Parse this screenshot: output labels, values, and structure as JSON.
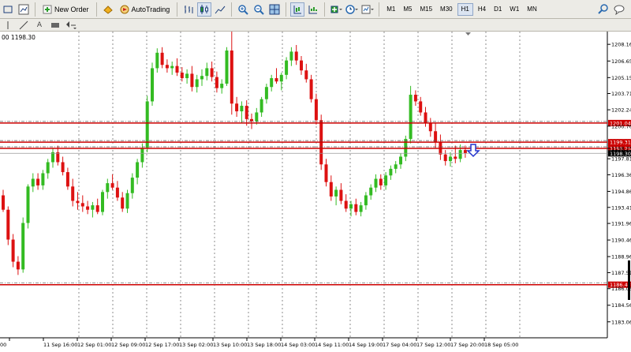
{
  "toolbar": {
    "new_order_label": "New Order",
    "autotrading_label": "AutoTrading",
    "timeframes": [
      "M1",
      "M5",
      "M15",
      "M30",
      "H1",
      "H4",
      "D1",
      "W1",
      "MN"
    ],
    "active_timeframe": "H1"
  },
  "toolbar2": {
    "text_tool_label": "A"
  },
  "chart_header": {
    "price_label": "00 1198.30"
  },
  "chart_data": {
    "type": "candlestick",
    "y_ticks": [
      "1208.16",
      "1206.65",
      "1205.15",
      "1203.71",
      "1202.24",
      "1200.76",
      "1198.75",
      "1197.81",
      "1196.36",
      "1194.86",
      "1193.41",
      "1191.96",
      "1190.46",
      "1188.96",
      "1187.51",
      "1186.06",
      "1184.56",
      "1183.06"
    ],
    "x_ticks": [
      "00",
      "11 Sep 16:00",
      "12 Sep 01:00",
      "12 Sep 09:00",
      "12 Sep 17:00",
      "13 Sep 02:00",
      "13 Sep 10:00",
      "13 Sep 18:00",
      "14 Sep 03:00",
      "14 Sep 11:00",
      "14 Sep 19:00",
      "17 Sep 04:00",
      "17 Sep 12:00",
      "17 Sep 20:00",
      "18 Sep 05:00"
    ],
    "ylim": [
      1182.9,
      1209.1
    ],
    "levels": [
      {
        "label": "1201.04",
        "value": 1201.04,
        "color": "#cc0000"
      },
      {
        "label": "1199.31",
        "value": 1199.31,
        "color": "#cc0000"
      },
      {
        "label": "1198.75",
        "value": 1198.75,
        "color": "#cc0000"
      },
      {
        "label": "1186.42",
        "value": 1186.42,
        "color": "#cc0000"
      }
    ],
    "bid": {
      "label": "1198.30",
      "value": 1198.3
    },
    "up_color": "#33bb22",
    "down_color": "#dd1111",
    "ohlc": [
      [
        1194.5,
        1195.0,
        1193.0,
        1193.2
      ],
      [
        1193.2,
        1193.5,
        1190.0,
        1190.5
      ],
      [
        1190.5,
        1191.0,
        1188.0,
        1188.5
      ],
      [
        1188.5,
        1189.0,
        1187.3,
        1187.8
      ],
      [
        1187.8,
        1192.5,
        1187.5,
        1192.0
      ],
      [
        1192.0,
        1195.5,
        1191.5,
        1195.3
      ],
      [
        1195.3,
        1196.5,
        1194.8,
        1196.0
      ],
      [
        1196.0,
        1196.5,
        1195.0,
        1195.4
      ],
      [
        1195.4,
        1196.8,
        1195.0,
        1196.5
      ],
      [
        1196.5,
        1197.8,
        1196.0,
        1197.5
      ],
      [
        1197.5,
        1198.8,
        1197.0,
        1198.4
      ],
      [
        1198.4,
        1199.0,
        1197.2,
        1197.5
      ],
      [
        1197.5,
        1198.0,
        1196.3,
        1196.6
      ],
      [
        1196.6,
        1197.0,
        1195.0,
        1195.3
      ],
      [
        1195.3,
        1196.0,
        1193.5,
        1194.0
      ],
      [
        1194.0,
        1194.8,
        1193.2,
        1193.8
      ],
      [
        1193.8,
        1194.5,
        1193.0,
        1193.5
      ],
      [
        1193.5,
        1194.0,
        1192.8,
        1193.2
      ],
      [
        1193.2,
        1193.9,
        1192.5,
        1193.6
      ],
      [
        1193.6,
        1194.2,
        1192.8,
        1193.0
      ],
      [
        1193.0,
        1195.0,
        1192.7,
        1194.8
      ],
      [
        1194.8,
        1196.0,
        1194.2,
        1195.6
      ],
      [
        1195.6,
        1196.4,
        1195.0,
        1195.2
      ],
      [
        1195.2,
        1195.8,
        1194.0,
        1194.3
      ],
      [
        1194.3,
        1194.8,
        1193.0,
        1193.3
      ],
      [
        1193.3,
        1195.0,
        1192.9,
        1194.7
      ],
      [
        1194.7,
        1196.5,
        1194.2,
        1196.1
      ],
      [
        1196.1,
        1197.8,
        1195.5,
        1197.5
      ],
      [
        1197.5,
        1199.2,
        1197.0,
        1198.8
      ],
      [
        1198.8,
        1203.5,
        1198.4,
        1203.0
      ],
      [
        1203.0,
        1206.5,
        1202.6,
        1206.0
      ],
      [
        1206.0,
        1207.8,
        1205.6,
        1207.4
      ],
      [
        1207.4,
        1207.9,
        1206.0,
        1206.3
      ],
      [
        1206.3,
        1206.8,
        1205.6,
        1206.0
      ],
      [
        1206.0,
        1206.6,
        1205.4,
        1206.2
      ],
      [
        1206.2,
        1206.9,
        1205.3,
        1205.6
      ],
      [
        1205.6,
        1206.1,
        1204.8,
        1205.1
      ],
      [
        1205.1,
        1205.9,
        1204.6,
        1205.5
      ],
      [
        1205.5,
        1206.2,
        1203.9,
        1204.3
      ],
      [
        1204.3,
        1205.4,
        1203.8,
        1205.0
      ],
      [
        1205.0,
        1205.9,
        1204.4,
        1205.3
      ],
      [
        1205.3,
        1206.5,
        1204.9,
        1206.0
      ],
      [
        1206.0,
        1206.6,
        1204.8,
        1205.2
      ],
      [
        1205.2,
        1205.7,
        1203.8,
        1204.2
      ],
      [
        1204.2,
        1205.0,
        1203.7,
        1204.6
      ],
      [
        1204.6,
        1207.9,
        1204.4,
        1207.6
      ],
      [
        1207.6,
        1209.4,
        1201.8,
        1202.8
      ],
      [
        1202.8,
        1203.4,
        1201.6,
        1202.1
      ],
      [
        1202.1,
        1203.0,
        1201.0,
        1202.6
      ],
      [
        1202.6,
        1203.1,
        1200.8,
        1201.4
      ],
      [
        1201.4,
        1201.9,
        1200.5,
        1201.2
      ],
      [
        1201.2,
        1202.4,
        1200.9,
        1202.0
      ],
      [
        1202.0,
        1203.4,
        1201.6,
        1203.2
      ],
      [
        1203.2,
        1204.6,
        1202.8,
        1204.3
      ],
      [
        1204.3,
        1205.4,
        1203.9,
        1205.1
      ],
      [
        1205.1,
        1206.0,
        1204.6,
        1204.8
      ],
      [
        1204.8,
        1205.6,
        1204.0,
        1205.4
      ],
      [
        1205.4,
        1207.0,
        1205.0,
        1206.7
      ],
      [
        1206.7,
        1207.9,
        1206.2,
        1207.5
      ],
      [
        1207.5,
        1208.1,
        1206.3,
        1206.7
      ],
      [
        1206.7,
        1207.1,
        1205.4,
        1205.8
      ],
      [
        1205.8,
        1206.4,
        1204.7,
        1205.0
      ],
      [
        1205.0,
        1205.4,
        1202.9,
        1203.2
      ],
      [
        1203.2,
        1203.7,
        1200.9,
        1201.3
      ],
      [
        1201.3,
        1201.8,
        1196.8,
        1197.3
      ],
      [
        1197.3,
        1197.8,
        1195.3,
        1195.7
      ],
      [
        1195.7,
        1196.3,
        1194.0,
        1194.4
      ],
      [
        1194.4,
        1195.3,
        1193.6,
        1195.0
      ],
      [
        1195.0,
        1195.6,
        1193.7,
        1194.0
      ],
      [
        1194.0,
        1194.6,
        1193.0,
        1193.3
      ],
      [
        1193.3,
        1194.0,
        1192.6,
        1193.7
      ],
      [
        1193.7,
        1194.2,
        1192.7,
        1193.0
      ],
      [
        1193.0,
        1193.9,
        1192.6,
        1193.6
      ],
      [
        1193.6,
        1194.8,
        1193.2,
        1194.5
      ],
      [
        1194.5,
        1195.5,
        1194.1,
        1195.2
      ],
      [
        1195.2,
        1196.4,
        1194.8,
        1196.0
      ],
      [
        1196.0,
        1196.4,
        1195.0,
        1195.4
      ],
      [
        1195.4,
        1196.6,
        1195.0,
        1196.3
      ],
      [
        1196.3,
        1197.2,
        1195.9,
        1196.9
      ],
      [
        1196.9,
        1197.6,
        1196.5,
        1197.3
      ],
      [
        1197.3,
        1198.3,
        1196.9,
        1198.0
      ],
      [
        1198.0,
        1199.9,
        1197.6,
        1199.6
      ],
      [
        1199.6,
        1204.4,
        1199.2,
        1203.6
      ],
      [
        1203.6,
        1204.0,
        1202.6,
        1203.0
      ],
      [
        1203.0,
        1203.4,
        1201.7,
        1202.0
      ],
      [
        1202.0,
        1202.5,
        1200.7,
        1201.0
      ],
      [
        1201.0,
        1201.5,
        1199.8,
        1200.3
      ],
      [
        1200.3,
        1201.0,
        1198.8,
        1199.3
      ],
      [
        1199.3,
        1200.0,
        1197.7,
        1198.2
      ],
      [
        1198.2,
        1198.6,
        1197.2,
        1197.6
      ],
      [
        1197.6,
        1198.4,
        1197.1,
        1198.0
      ],
      [
        1198.0,
        1199.0,
        1197.4,
        1197.8
      ],
      [
        1197.8,
        1199.1,
        1197.5,
        1198.6
      ],
      [
        1198.6,
        1199.0,
        1197.9,
        1198.3
      ]
    ]
  }
}
